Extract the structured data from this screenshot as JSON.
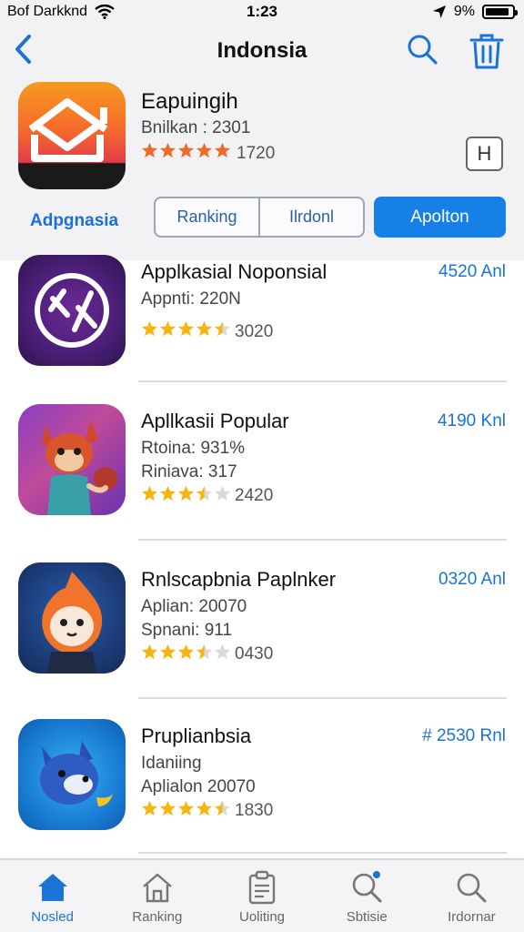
{
  "status_bar": {
    "carrier": "Bof Darkknd",
    "time": "1:23",
    "battery": "9%",
    "battery_level": 0.9
  },
  "nav": {
    "title": "Indonsia",
    "back_icon": "chevron-left-icon",
    "search_icon": "search-icon",
    "trash_icon": "trash-icon"
  },
  "featured": {
    "title": "Eapuingih",
    "subtitle": "Bnilkan : 2301",
    "rating": 5,
    "count": "1720",
    "button_label": "H"
  },
  "segments": {
    "label": "Adpgnasia",
    "items": [
      "Ranking",
      "Ilrdonl"
    ],
    "active": "Apolton"
  },
  "apps": [
    {
      "name": "Applkasial Noponsial",
      "price": "4520 Anl",
      "meta1": "Appnti: 220N",
      "meta2": "",
      "rating": 4.5,
      "count": "3020"
    },
    {
      "name": "Apllkasii Popular",
      "price": "4190 Knl",
      "meta1": "Rtoina: 931%",
      "meta2": "Riniava: 317",
      "rating": 3.5,
      "count": "2420"
    },
    {
      "name": "Rnlscapbnia Paplnker",
      "price": "0320 Anl",
      "meta1": "Aplian: 20070",
      "meta2": "Spnani: 911",
      "rating": 3.5,
      "count": "0430"
    },
    {
      "name": "Pruplianbsia",
      "price": "# 2530 Rnl",
      "meta1": "Idaniing",
      "meta2": "Aplialon 20070",
      "rating": 4.5,
      "count": "1830"
    }
  ],
  "tabs": [
    {
      "label": "Nosled",
      "icon": "home-icon",
      "active": true
    },
    {
      "label": "Ranking",
      "icon": "house-outline-icon",
      "active": false
    },
    {
      "label": "Uoliting",
      "icon": "clipboard-icon",
      "active": false
    },
    {
      "label": "Sbtisie",
      "icon": "search-badge-icon",
      "active": false
    },
    {
      "label": "Irdornar",
      "icon": "search-icon",
      "active": false
    }
  ],
  "colors": {
    "accent": "#1680e6",
    "star": "#f5b40f",
    "featured_star": "#ef6a2b"
  }
}
